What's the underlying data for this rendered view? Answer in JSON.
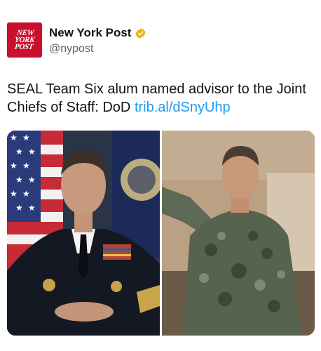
{
  "account": {
    "logo_text": "NEW\nYORK\nPOST",
    "display_name": "New York Post",
    "verified_icon": "gold-verified-badge",
    "handle": "@nypost"
  },
  "tweet": {
    "text": "SEAL Team Six alum named advisor to the Joint Chiefs of Staff: DoD ",
    "link_text": "trib.al/dSnyUhp"
  },
  "media": {
    "photo_count": 2
  },
  "colors": {
    "brand_red": "#c8102e",
    "link_blue": "#1d9bf0",
    "verified_gold": "#e2b719",
    "text_primary": "#0f1419",
    "text_secondary": "#536471"
  }
}
